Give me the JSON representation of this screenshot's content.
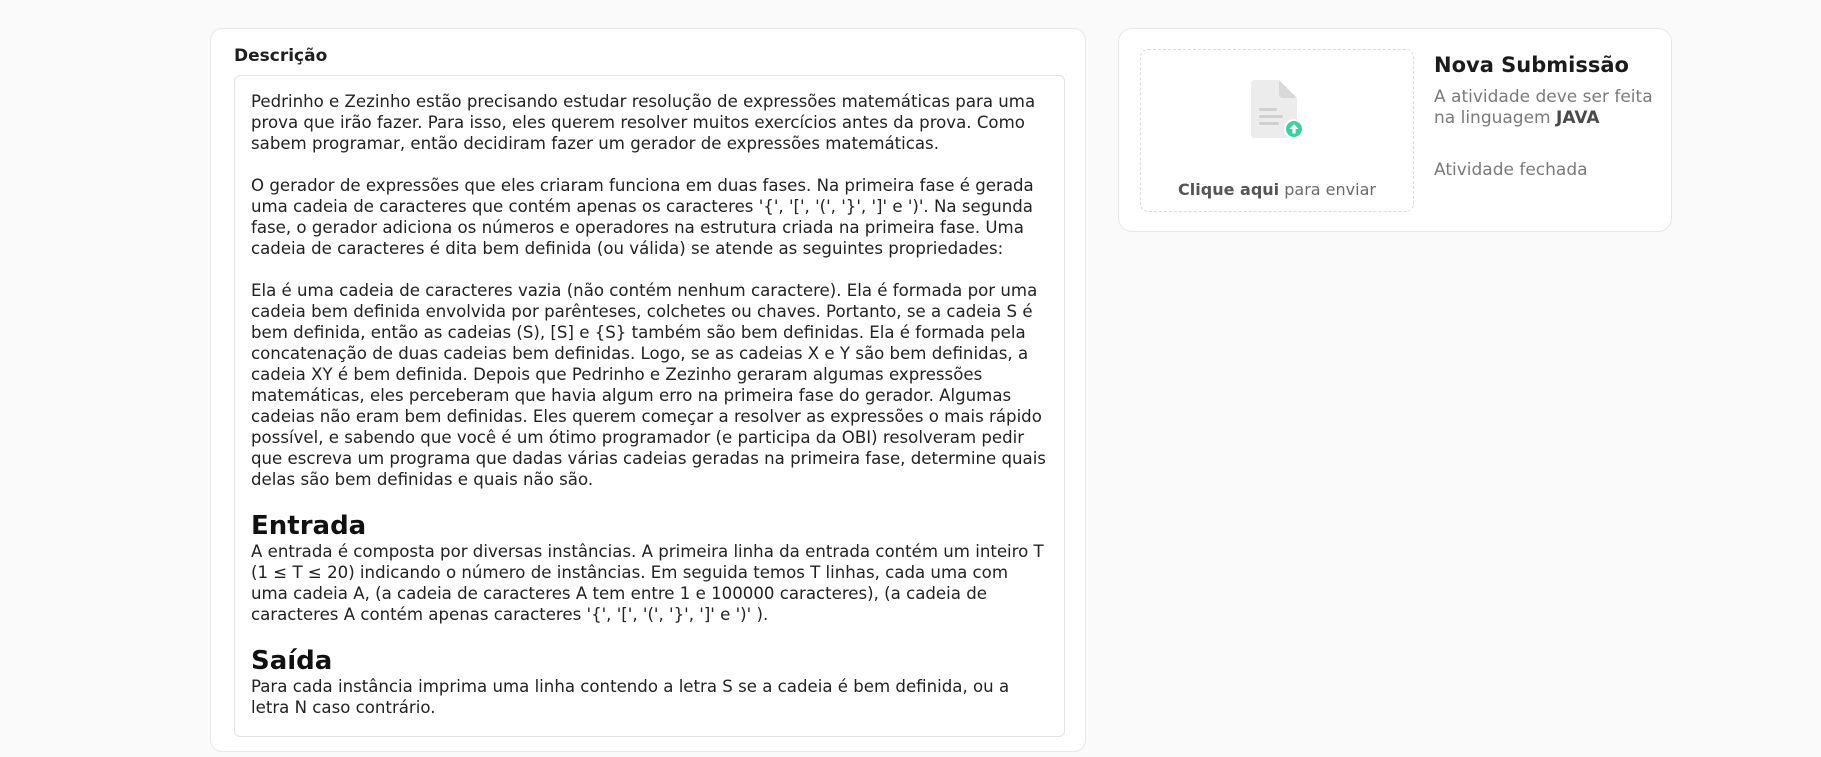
{
  "description": {
    "heading": "Descrição",
    "paragraphs": [
      "Pedrinho e Zezinho estão precisando estudar resolução de expressões matemáticas para uma prova que irão fazer. Para isso, eles querem resolver muitos exercícios antes da prova. Como sabem programar, então decidiram fazer um gerador de expressões matemáticas.",
      "O gerador de expressões que eles criaram funciona em duas fases. Na primeira fase é gerada uma cadeia de caracteres que contém apenas os caracteres '{', '[', '(', '}', ']' e ')'. Na segunda fase, o gerador adiciona os números e operadores na estrutura criada na primeira fase. Uma cadeia de caracteres é dita bem definida (ou válida) se atende as seguintes propriedades:",
      "Ela é uma cadeia de caracteres vazia (não contém nenhum caractere). Ela é formada por uma cadeia bem definida envolvida por parênteses, colchetes ou chaves. Portanto, se a cadeia S é bem definida, então as cadeias (S), [S] e {S} também são bem definidas. Ela é formada pela concatenação de duas cadeias bem definidas. Logo, se as cadeias X e Y são bem definidas, a cadeia XY é bem definida. Depois que Pedrinho e Zezinho geraram algumas expressões matemáticas, eles perceberam que havia algum erro na primeira fase do gerador. Algumas cadeias não eram bem definidas. Eles querem começar a resolver as expressões o mais rápido possível, e sabendo que você é um ótimo programador (e participa da OBI) resolveram pedir que escreva um programa que dadas várias cadeias geradas na primeira fase, determine quais delas são bem definidas e quais não são."
    ],
    "input_heading": "Entrada",
    "input_text": "A entrada é composta por diversas instâncias. A primeira linha da entrada contém um inteiro T (1 ≤ T ≤ 20) indicando o número de instâncias. Em seguida temos T linhas, cada uma com uma cadeia A, (a cadeia de caracteres A tem entre 1 e 100000 caracteres), (a cadeia de caracteres A contém apenas caracteres '{', '[', '(', '}', ']' e ')' ).",
    "output_heading": "Saída",
    "output_text": "Para cada instância imprima uma linha contendo a letra S se a cadeia é bem definida, ou a letra N caso contrário."
  },
  "submission": {
    "title": "Nova Submissão",
    "upload_link": "Clique aqui",
    "upload_suffix": " para enviar",
    "language_prefix": "A atividade deve ser feita na linguagem ",
    "language": "JAVA",
    "status": "Atividade fechada",
    "icon": "file-upload-icon",
    "accent_color": "#3ecf9a"
  }
}
